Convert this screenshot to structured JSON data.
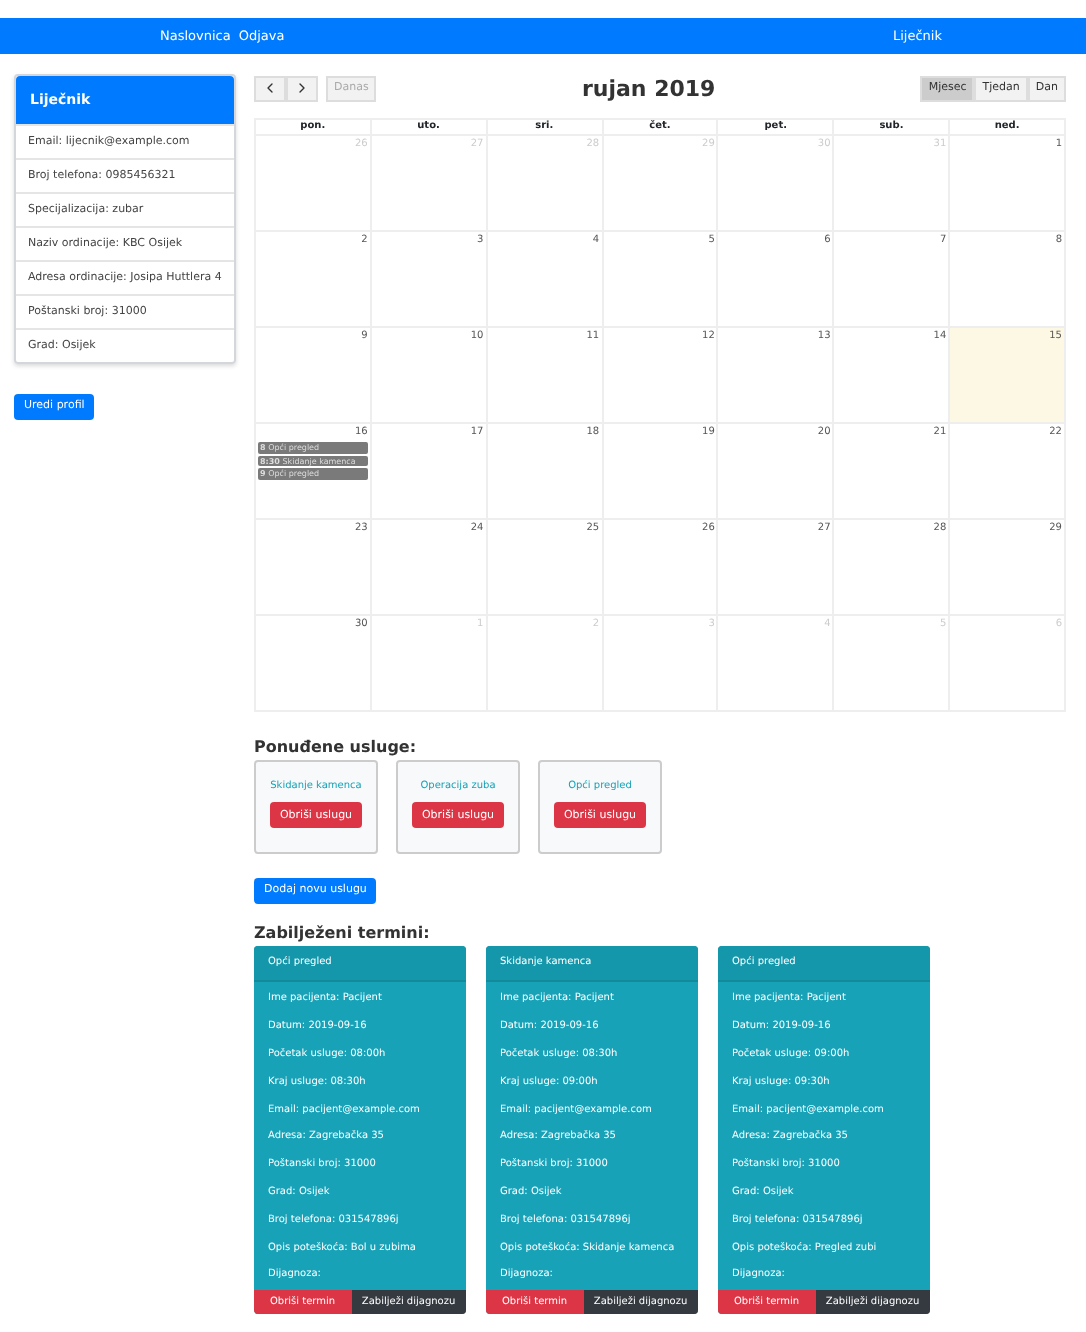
{
  "nav": {
    "links": [
      "Naslovnica",
      "Odjava"
    ],
    "user": "Liječnik"
  },
  "profile": {
    "title": "Liječnik",
    "fields": [
      "Email: lijecnik@example.com",
      "Broj telefona: 0985456321",
      "Specijalizacija: zubar",
      "Naziv ordinacije: KBC Osijek",
      "Adresa ordinacije: Josipa Huttlera 4",
      "Poštanski broj: 31000",
      "Grad: Osijek"
    ],
    "button": "Uredi profil"
  },
  "calendar": {
    "today_button": {
      "label": "Danas",
      "disabled": true
    },
    "title": "rujan 2019",
    "views": [
      {
        "label": "Mjesec",
        "selected": true
      },
      {
        "label": "Tjedan",
        "selected": false
      },
      {
        "label": "Dan",
        "selected": false
      }
    ],
    "weekdays": [
      "pon.",
      "uto.",
      "sri.",
      "čet.",
      "pet.",
      "sub.",
      "ned."
    ],
    "weeks": [
      [
        {
          "day": "26",
          "other_month": true
        },
        {
          "day": "27",
          "other_month": true
        },
        {
          "day": "28",
          "other_month": true
        },
        {
          "day": "29",
          "other_month": true
        },
        {
          "day": "30",
          "other_month": true
        },
        {
          "day": "31",
          "other_month": true
        },
        {
          "day": "1",
          "other_month": false
        }
      ],
      [
        {
          "day": "2",
          "other_month": false
        },
        {
          "day": "3",
          "other_month": false
        },
        {
          "day": "4",
          "other_month": false
        },
        {
          "day": "5",
          "other_month": false
        },
        {
          "day": "6",
          "other_month": false
        },
        {
          "day": "7",
          "other_month": false
        },
        {
          "day": "8",
          "other_month": false
        }
      ],
      [
        {
          "day": "9",
          "other_month": false
        },
        {
          "day": "10",
          "other_month": false
        },
        {
          "day": "11",
          "other_month": false
        },
        {
          "day": "12",
          "other_month": false
        },
        {
          "day": "13",
          "other_month": false
        },
        {
          "day": "14",
          "other_month": false
        },
        {
          "day": "15",
          "other_month": false,
          "today": true
        }
      ],
      [
        {
          "day": "16",
          "other_month": false,
          "events": [
            {
              "time": "8",
              "title": "Opći pregled"
            },
            {
              "time": "8:30",
              "title": "Skidanje kamenca"
            },
            {
              "time": "9",
              "title": "Opći pregled"
            }
          ]
        },
        {
          "day": "17",
          "other_month": false
        },
        {
          "day": "18",
          "other_month": false
        },
        {
          "day": "19",
          "other_month": false
        },
        {
          "day": "20",
          "other_month": false
        },
        {
          "day": "21",
          "other_month": false
        },
        {
          "day": "22",
          "other_month": false
        }
      ],
      [
        {
          "day": "23",
          "other_month": false
        },
        {
          "day": "24",
          "other_month": false
        },
        {
          "day": "25",
          "other_month": false
        },
        {
          "day": "26",
          "other_month": false
        },
        {
          "day": "27",
          "other_month": false
        },
        {
          "day": "28",
          "other_month": false
        },
        {
          "day": "29",
          "other_month": false
        }
      ],
      [
        {
          "day": "30",
          "other_month": false
        },
        {
          "day": "1",
          "other_month": true
        },
        {
          "day": "2",
          "other_month": true
        },
        {
          "day": "3",
          "other_month": true
        },
        {
          "day": "4",
          "other_month": true
        },
        {
          "day": "5",
          "other_month": true
        },
        {
          "day": "6",
          "other_month": true
        }
      ]
    ]
  },
  "services": {
    "heading": "Ponuđene usluge:",
    "items": [
      {
        "name": "Skidanje kamenca",
        "button": "Obriši uslugu"
      },
      {
        "name": "Operacija zuba",
        "button": "Obriši uslugu"
      },
      {
        "name": "Opći pregled",
        "button": "Obriši uslugu"
      }
    ],
    "add_button": "Dodaj novu uslugu"
  },
  "appointments": {
    "heading": "Zabilježeni termini:",
    "items": [
      {
        "title": "Opći pregled",
        "lines": [
          "Ime pacijenta: Pacijent",
          "Datum: 2019-09-16",
          "Početak usluge: 08:00h",
          "Kraj usluge: 08:30h",
          "Email: pacijent@example.com",
          "Adresa: Zagrebačka 35",
          "Poštanski broj: 31000",
          "Grad: Osijek",
          "Broj telefona: 031547896j",
          "Opis poteškoća: Bol u zubima",
          "Dijagnoza:"
        ],
        "delete_button": "Obriši termin",
        "diagnosis_button": "Zabilježi dijagnozu"
      },
      {
        "title": "Skidanje kamenca",
        "lines": [
          "Ime pacijenta: Pacijent",
          "Datum: 2019-09-16",
          "Početak usluge: 08:30h",
          "Kraj usluge: 09:00h",
          "Email: pacijent@example.com",
          "Adresa: Zagrebačka 35",
          "Poštanski broj: 31000",
          "Grad: Osijek",
          "Broj telefona: 031547896j",
          "Opis poteškoća: Skidanje kamenca",
          "Dijagnoza:"
        ],
        "delete_button": "Obriši termin",
        "diagnosis_button": "Zabilježi dijagnozu"
      },
      {
        "title": "Opći pregled",
        "lines": [
          "Ime pacijenta: Pacijent",
          "Datum: 2019-09-16",
          "Početak usluge: 09:00h",
          "Kraj usluge: 09:30h",
          "Email: pacijent@example.com",
          "Adresa: Zagrebačka 35",
          "Poštanski broj: 31000",
          "Grad: Osijek",
          "Broj telefona: 031547896j",
          "Opis poteškoća: Pregled zubi",
          "Dijagnoza:"
        ],
        "delete_button": "Obriši termin",
        "diagnosis_button": "Zabilježi dijagnozu"
      }
    ]
  }
}
